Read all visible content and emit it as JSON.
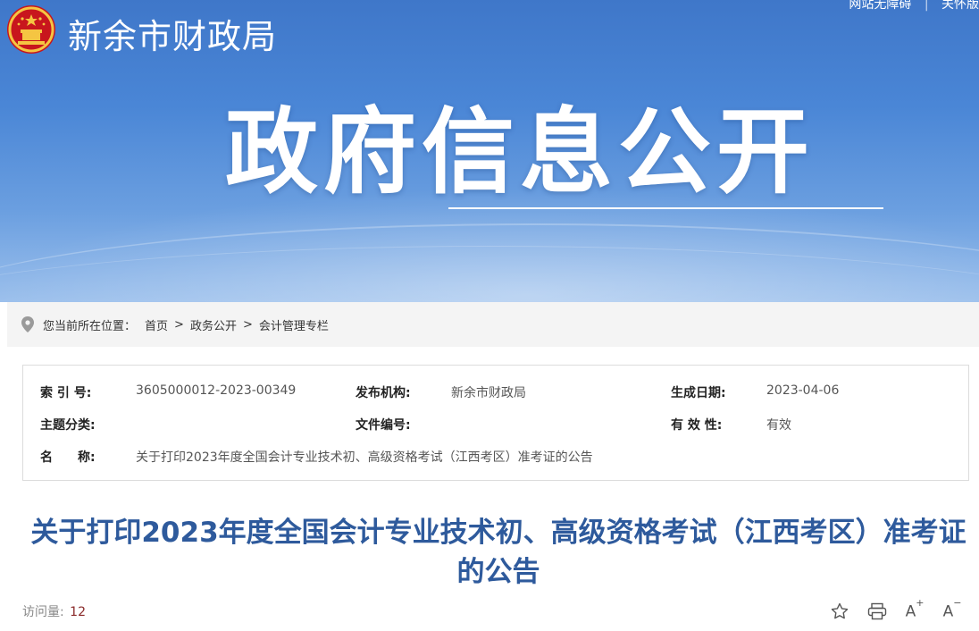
{
  "header": {
    "site_name": "新余市财政局",
    "top_links": [
      "网站无障碍",
      "关怀版"
    ],
    "banner_title": "政府信息公开",
    "emblem_icon": "national-emblem-icon"
  },
  "breadcrumb": {
    "prefix": "您当前所在位置：",
    "items": [
      "首页",
      "政务公开",
      "会计管理专栏"
    ],
    "separator": ">"
  },
  "info": {
    "index_label": "索 引 号:",
    "index_value": "3605000012-2023-00349",
    "publisher_label": "发布机构:",
    "publisher_value": "新余市财政局",
    "date_label": "生成日期:",
    "date_value": "2023-04-06",
    "topic_label": "主题分类:",
    "topic_value": "",
    "docno_label": "文件编号:",
    "docno_value": "",
    "validity_label": "有 效 性:",
    "validity_value": "有效",
    "name_label": "名　　称:",
    "name_value": "关于打印2023年度全国会计专业技术初、高级资格考试（江西考区）准考证的公告"
  },
  "article": {
    "title": "关于打印2023年度全国会计专业技术初、高级资格考试（江西考区）准考证的公告",
    "visits_label": "访问量:",
    "visits_count": "12"
  },
  "toolbar": {
    "icons": [
      "star-icon",
      "print-icon",
      "font-increase-icon",
      "font-decrease-icon"
    ],
    "font_increase": "A",
    "font_decrease": "A"
  },
  "colors": {
    "banner": "#4a86d6",
    "title": "#2e5a9c",
    "visit_count": "#8a2a2a"
  }
}
